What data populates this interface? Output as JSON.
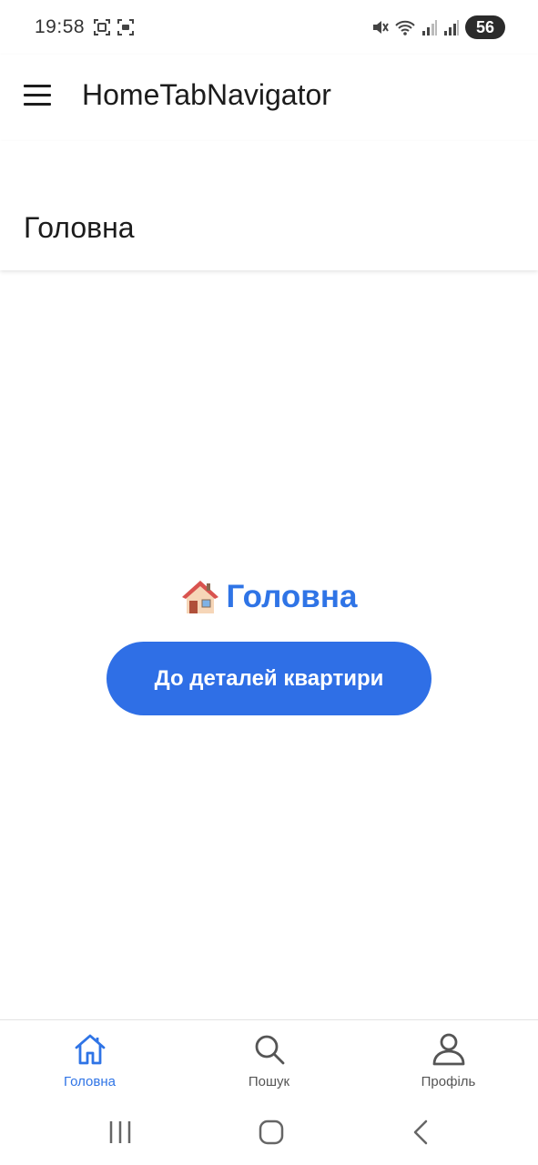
{
  "status_bar": {
    "time": "19:58",
    "battery": "56",
    "icons": [
      "screenshot-icon",
      "screen-record-icon",
      "mute-icon",
      "wifi-icon",
      "signal-icon",
      "signal-icon-2"
    ]
  },
  "app_header": {
    "title": "HomeTabNavigator",
    "menu_icon": "hamburger-menu-icon"
  },
  "screen_header": {
    "title": "Головна"
  },
  "content": {
    "heading_emoji": "house-emoji",
    "heading": "Головна",
    "button_label": "До деталей квартири"
  },
  "tab_bar": {
    "tabs": [
      {
        "label": "Головна",
        "icon": "home-icon",
        "active": true
      },
      {
        "label": "Пошук",
        "icon": "search-icon",
        "active": false
      },
      {
        "label": "Профіль",
        "icon": "person-icon",
        "active": false
      }
    ]
  },
  "nav_bar": {
    "buttons": [
      "recent-apps-icon",
      "home-nav-icon",
      "back-icon"
    ]
  },
  "colors": {
    "accent": "#2f74e6",
    "button": "#2f6fe6",
    "inactive": "#555555"
  }
}
